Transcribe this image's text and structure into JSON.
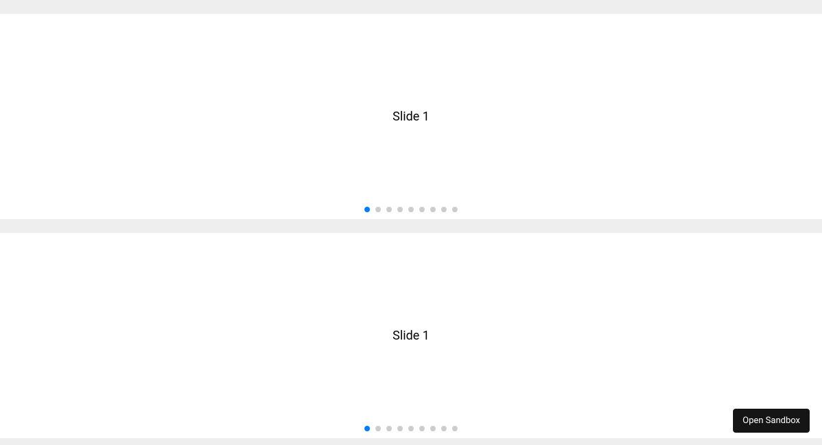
{
  "carousels": [
    {
      "current_slide_label": "Slide 1",
      "active_index": 0,
      "bullet_count": 9
    },
    {
      "current_slide_label": "Slide 1",
      "active_index": 0,
      "bullet_count": 9
    }
  ],
  "sandbox_button_label": "Open Sandbox"
}
